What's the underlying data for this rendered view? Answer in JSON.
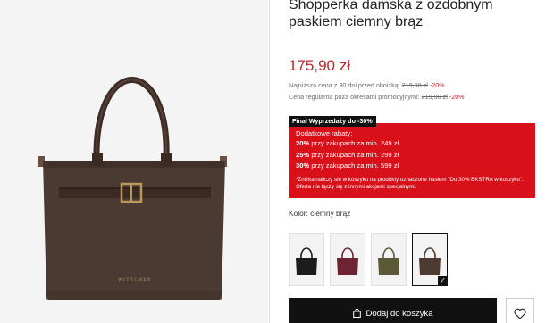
{
  "product": {
    "title": "Shopperka damska z ozdobnym paskiem ciemny brąz",
    "brand_mark": "WITTCHEN",
    "price": "175,90 zł",
    "lowest_price_note": {
      "label": "Najniższa cena z 30 dni przed obniżką:",
      "old_price": "219,90 zł",
      "discount": "-20%"
    },
    "regular_price_note": {
      "label": "Cena regularna poza okresami promocyjnymi:",
      "old_price": "219,90 zł",
      "discount": "-20%"
    }
  },
  "sale_tag": "Finał Wyprzedaży do -30%",
  "promo": {
    "heading": "Dodatkowe rabaty:",
    "tiers": [
      {
        "percent": "20%",
        "text": "przy zakupach za min. 249 zł"
      },
      {
        "percent": "25%",
        "text": "przy zakupach za min. 299 zł"
      },
      {
        "percent": "30%",
        "text": "przy zakupach za min. 599 zł"
      }
    ],
    "fine_print": "*Zniżka naliczy się w koszyku na produkty oznaczone hasłem \"Do 30% EKSTRA w koszyku\". Oferta nie łączy się z innymi akcjami specjalnymi."
  },
  "color": {
    "label": "Kolor: ciemny brąz",
    "swatches": [
      {
        "name": "czarny",
        "color": "#1c1c1e",
        "selected": false
      },
      {
        "name": "bordowy",
        "color": "#6e2334",
        "selected": false
      },
      {
        "name": "oliwkowy",
        "color": "#5a5a36",
        "selected": false
      },
      {
        "name": "ciemny brąz",
        "color": "#4d3a30",
        "selected": true
      }
    ]
  },
  "actions": {
    "add_to_cart": "Dodaj do koszyka"
  },
  "colors": {
    "accent_red": "#d7101a",
    "price_red": "#c4242b",
    "bag_brown": "#4a3a31"
  }
}
